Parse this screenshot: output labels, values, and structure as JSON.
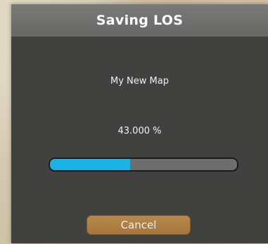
{
  "dialog": {
    "title": "Saving LOS",
    "map_name": "My New Map",
    "progress_text": "43.000 %",
    "progress_fraction": 0.43,
    "cancel_label": "Cancel"
  },
  "colors": {
    "dialog_bg": "#414140",
    "title_bar": "#6e6e6c",
    "progress_fill": "#1ab3e4",
    "progress_track": "#6e6e6e",
    "cancel_button": "#ab7d42"
  }
}
